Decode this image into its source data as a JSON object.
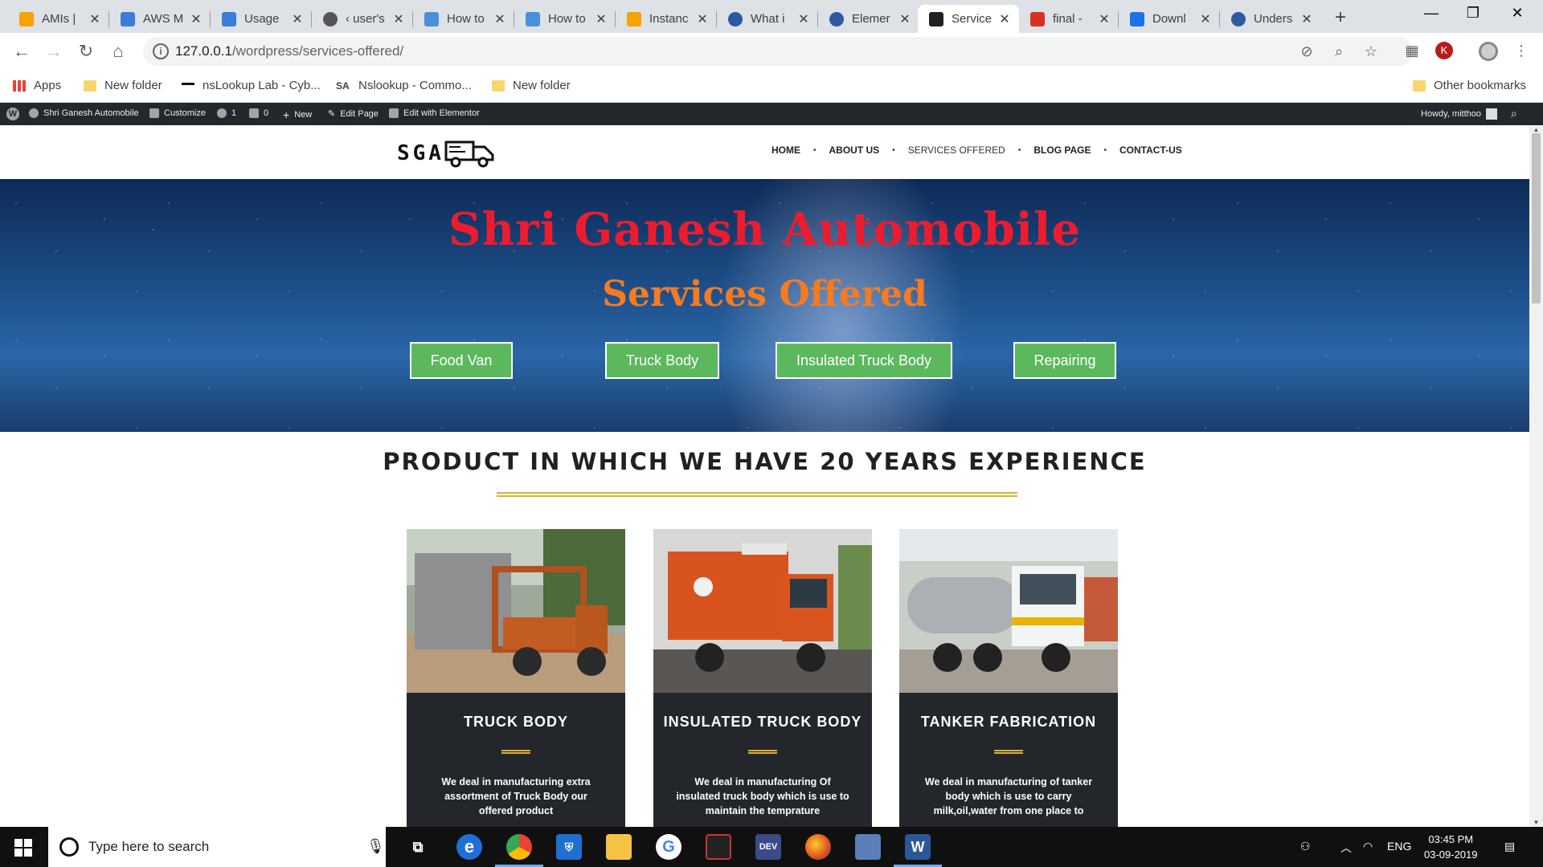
{
  "browser": {
    "tabs": [
      {
        "title": "AMIs |",
        "icon": "aws-box-icon",
        "color": "#f4a300"
      },
      {
        "title": "AWS M",
        "icon": "aws-cubes-icon",
        "color": "#3b7dd8"
      },
      {
        "title": "Usage",
        "icon": "aws-cubes-icon",
        "color": "#3b7dd8"
      },
      {
        "title": "‹ user's",
        "icon": "globe-icon",
        "color": "#555555"
      },
      {
        "title": "How to",
        "icon": "linux-icon",
        "color": "#4a90d9"
      },
      {
        "title": "How to",
        "icon": "linux-icon",
        "color": "#4a90d9"
      },
      {
        "title": "Instanc",
        "icon": "aws-box-icon",
        "color": "#f4a300"
      },
      {
        "title": "What i",
        "icon": "bing-icon",
        "color": "#2d5a9e"
      },
      {
        "title": "Elemer",
        "icon": "bing-icon",
        "color": "#2d5a9e"
      },
      {
        "title": "Service",
        "icon": "truck-icon",
        "color": "#222222"
      },
      {
        "title": "final - ",
        "icon": "gmail-icon",
        "color": "#d93025"
      },
      {
        "title": "Downl",
        "icon": "download-icon",
        "color": "#1a73e8"
      },
      {
        "title": "Unders",
        "icon": "bing-icon",
        "color": "#2d5a9e"
      }
    ],
    "url_host": "127.0.0.1",
    "url_path": "/wordpress/services-offered/",
    "bookmarks": [
      "Apps",
      "New folder",
      "nsLookup Lab - Cyb...",
      "Nslookup - Commo...",
      "New folder"
    ],
    "bookmarks_other": "Other bookmarks",
    "profile_initial": "K"
  },
  "wpbar": {
    "site": "Shri Ganesh Automobile",
    "customize": "Customize",
    "updates": "1",
    "comments": "0",
    "new": "New",
    "edit_page": "Edit Page",
    "elementor": "Edit with Elementor",
    "howdy": "Howdy, mitthoo"
  },
  "site": {
    "logo": "SGA",
    "menu": [
      "HOME",
      "ABOUT US",
      "SERVICES OFFERED",
      "BLOG PAGE",
      "CONTACT-US"
    ],
    "hero_title": "Shri Ganesh Automobile",
    "hero_subtitle": "Services Offered",
    "hero_buttons": [
      "Food Van",
      "Truck Body",
      "Insulated Truck Body",
      "Repairing"
    ],
    "section_title": "PRODUCT IN WHICH WE HAVE 20 YEARS EXPERIENCE",
    "cards": [
      {
        "title": "TRUCK BODY",
        "text": "We deal in manufacturing extra assortment of Truck Body our offered product"
      },
      {
        "title": "INSULATED TRUCK BODY",
        "text": "We deal in manufacturing Of insulated truck body which is use to maintain the temprature"
      },
      {
        "title": "TANKER FABRICATION",
        "text": "We deal in manufacturing of tanker body which is use to carry milk,oil,water from one place to"
      }
    ]
  },
  "taskbar": {
    "search_placeholder": "Type here to search",
    "language": "ENG",
    "time": "03:45 PM",
    "date": "03-09-2019"
  },
  "colors": {
    "hero_title": "#ec1c30",
    "hero_subtitle": "#f47b20",
    "button_green": "#5cb85c",
    "accent_gold": "#e0b22c",
    "card_dark": "#23262b",
    "wpbar": "#23282d"
  }
}
